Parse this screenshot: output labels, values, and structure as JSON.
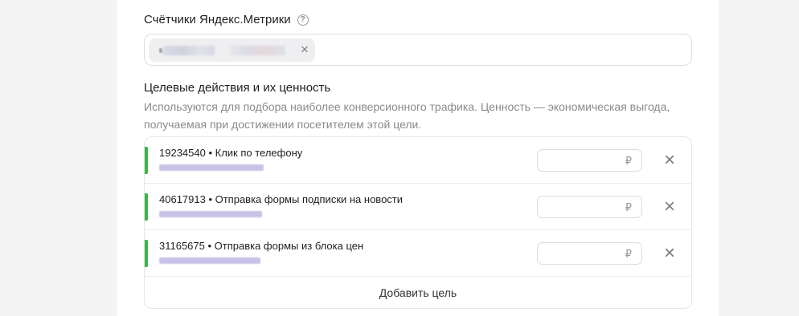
{
  "counters": {
    "title": "Счётчики Яндекс.Метрики",
    "help_icon": "?"
  },
  "goals": {
    "title": "Целевые действия и их ценность",
    "description": "Используются для подбора наиболее конверсионного трафика. Ценность — экономическая выгода, получаемая при достижении посетителем этой цели.",
    "items": [
      {
        "title": "19234540 • Клик по телефону",
        "currency": "₽"
      },
      {
        "title": "40617913 • Отправка формы подписки на новости",
        "currency": "₽"
      },
      {
        "title": "31165675 • Отправка формы из блока цен",
        "currency": "₽"
      }
    ],
    "add_label": "Добавить цель"
  },
  "icons": {
    "chip_close": "×",
    "remove": "×"
  },
  "colors": {
    "goal_bar": "#3bb54a",
    "redaction": "#c9c1e6"
  }
}
